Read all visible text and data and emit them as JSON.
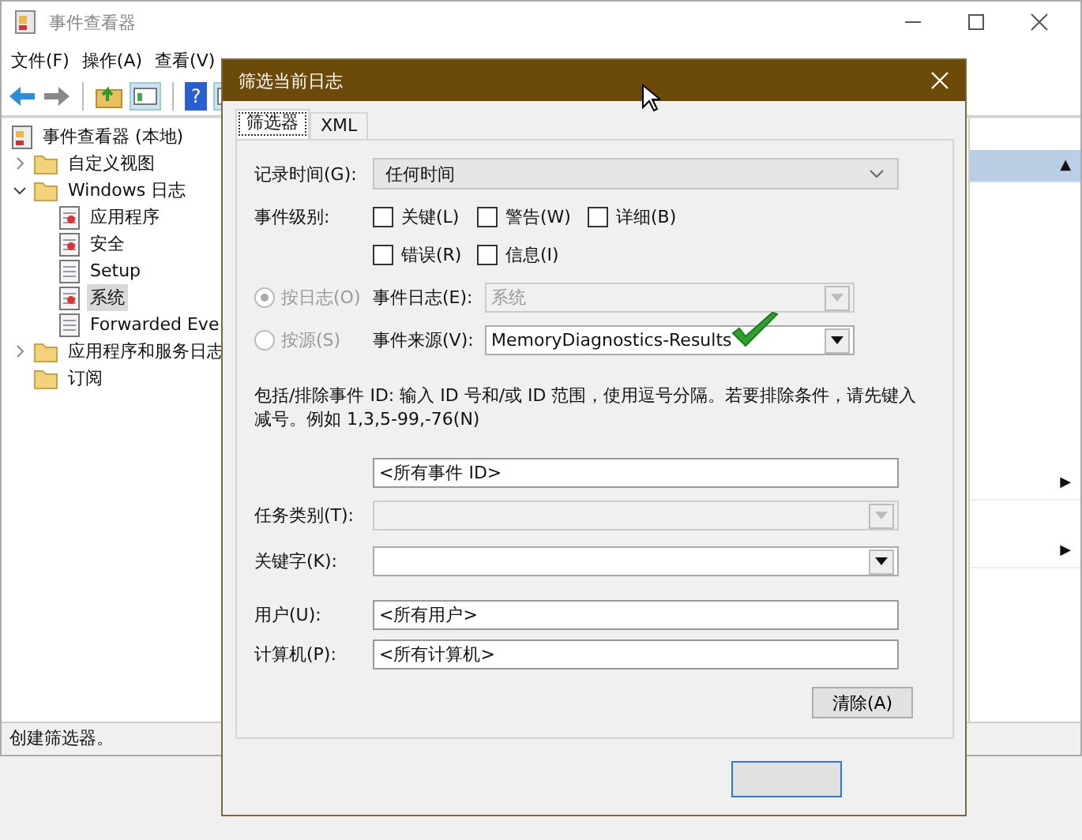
{
  "window": {
    "title": "事件查看器"
  },
  "menu": [
    {
      "label": "文件(F)"
    },
    {
      "label": "操作(A)"
    },
    {
      "label": "查看(V)"
    }
  ],
  "toolbar": {
    "help": "?"
  },
  "tree": [
    {
      "label": "事件查看器 (本地)",
      "kind": "root",
      "selected": false,
      "children": [
        {
          "label": "自定义视图",
          "kind": "folder",
          "expanded": false,
          "selected": false
        },
        {
          "label": "Windows 日志",
          "kind": "folder",
          "expanded": true,
          "selected": false,
          "children": [
            {
              "label": "应用程序",
              "kind": "log",
              "selected": false
            },
            {
              "label": "安全",
              "kind": "log",
              "selected": false
            },
            {
              "label": "Setup",
              "kind": "plain",
              "selected": false
            },
            {
              "label": "系统",
              "kind": "log",
              "selected": true
            },
            {
              "label": "Forwarded Eve",
              "kind": "plain",
              "selected": false
            }
          ]
        },
        {
          "label": "应用程序和服务日志",
          "kind": "folder",
          "expanded": false,
          "selected": false
        },
        {
          "label": "订阅",
          "kind": "folder",
          "selected": false
        }
      ]
    }
  ],
  "actions": [
    {
      "arrow": "▲",
      "selected": true
    },
    {
      "arrow": "▶",
      "selected": false
    },
    {
      "arrow": "▶",
      "selected": false
    }
  ],
  "status_bar": "创建筛选器。",
  "dialog": {
    "title": "筛选当前日志",
    "tabs": [
      {
        "label": "筛选器",
        "selected": true
      },
      {
        "label": "XML",
        "selected": false
      }
    ],
    "logged": {
      "label": "记录时间(G):",
      "value": "任何时间"
    },
    "levels": {
      "label": "事件级别:",
      "rows": [
        [
          {
            "label": "关键(L)",
            "checked": false
          },
          {
            "label": "警告(W)",
            "checked": false
          },
          {
            "label": "详细(B)",
            "checked": false
          }
        ],
        [
          {
            "label": "错误(R)",
            "checked": false
          },
          {
            "label": "信息(I)",
            "checked": false
          }
        ]
      ]
    },
    "sources": [
      {
        "label": "按日志(O)",
        "selected": true,
        "disabled": true,
        "field_label": "事件日志(E):",
        "value": "系统",
        "field_disabled": true
      },
      {
        "label": "按源(S)",
        "selected": false,
        "disabled": true,
        "field_label": "事件来源(V):",
        "value": "MemoryDiagnostics-Results",
        "field_disabled": false
      }
    ],
    "description": "包括/排除事件 ID: 输入 ID 号和/或 ID 范围，使用逗号分隔。若要排除条件，请先键入减号。例如 1,3,5-99,-76(N)",
    "event_id": "<所有事件 ID>",
    "fields": [
      {
        "label": "任务类别(T):",
        "kind": "combo",
        "disabled": true
      },
      {
        "label": "关键字(K):",
        "kind": "combo",
        "disabled": false
      },
      {
        "label": "用户(U):",
        "kind": "text",
        "value": "<所有用户>"
      },
      {
        "label": "计算机(P):",
        "kind": "text",
        "value": "<所有计算机>"
      }
    ],
    "clear_button": "清除(A)"
  }
}
